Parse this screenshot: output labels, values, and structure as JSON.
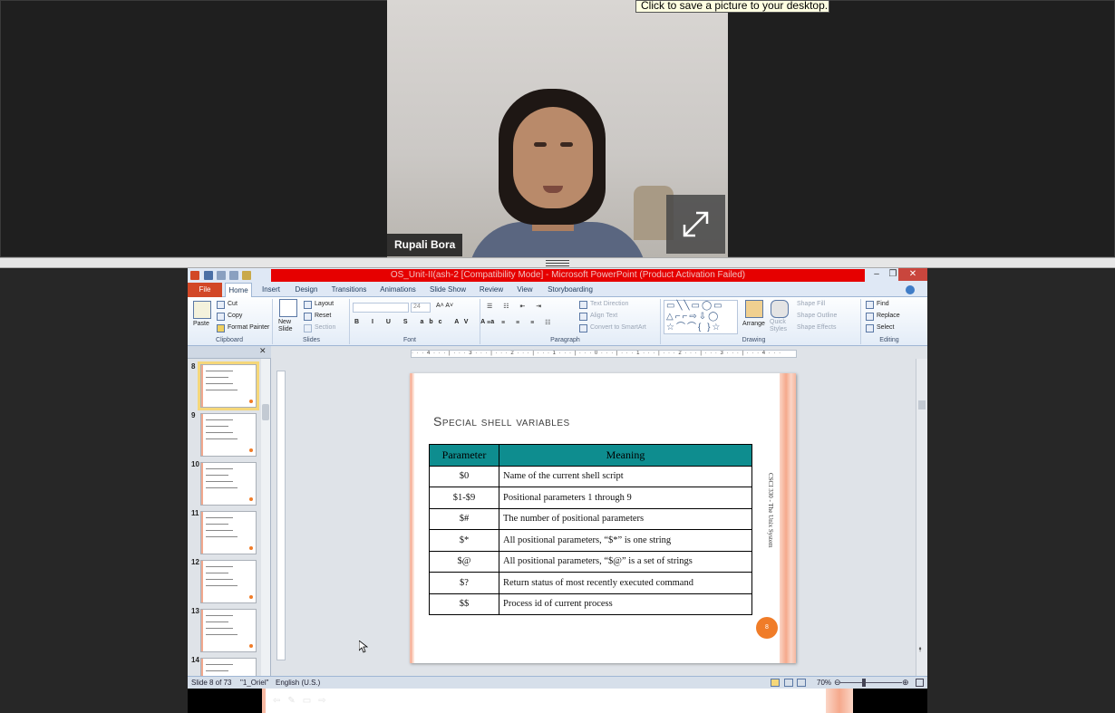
{
  "meeting": {
    "participant_name": "Rupali Bora",
    "tooltip": "Click to save a picture to your desktop."
  },
  "powerpoint": {
    "window_title": "OS_Unit-II(ash-2 [Compatibility Mode] - Microsoft PowerPoint (Product Activation Failed)",
    "tabs": [
      "File",
      "Home",
      "Insert",
      "Design",
      "Transitions",
      "Animations",
      "Slide Show",
      "Review",
      "View",
      "Storyboarding"
    ],
    "active_tab": "Home",
    "ribbon": {
      "clipboard": {
        "paste": "Paste",
        "cut": "Cut",
        "copy": "Copy",
        "format_painter": "Format Painter",
        "label": "Clipboard"
      },
      "slides": {
        "new_slide": "New Slide",
        "layout": "Layout",
        "reset": "Reset",
        "section": "Section",
        "label": "Slides"
      },
      "font": {
        "size": "24",
        "label": "Font"
      },
      "paragraph": {
        "text_direction": "Text Direction",
        "align_text": "Align Text",
        "convert_smartart": "Convert to SmartArt",
        "label": "Paragraph"
      },
      "drawing": {
        "arrange": "Arrange",
        "quick_styles": "Quick Styles",
        "shape_fill": "Shape Fill",
        "shape_outline": "Shape Outline",
        "shape_effects": "Shape Effects",
        "label": "Drawing"
      },
      "editing": {
        "find": "Find",
        "replace": "Replace",
        "select": "Select",
        "label": "Editing"
      }
    },
    "thumbnail_numbers": [
      "8",
      "9",
      "10",
      "11",
      "12",
      "13",
      "14"
    ],
    "ruler": "· · · 4 · · · | · · · 3 · · · | · · · 2 · · · | · · · 1 · · · | · · · 0 · · · | · · · 1 · · · | · · · 2 · · · | · · · 3 · · · | · · · 4 · · ·",
    "slide": {
      "title": "Special shell variables",
      "columns": [
        "Parameter",
        "Meaning"
      ],
      "rows": [
        [
          "$0",
          "Name of the current shell script"
        ],
        [
          "$1-$9",
          "Positional parameters 1 through 9"
        ],
        [
          "$#",
          "The number of positional parameters"
        ],
        [
          "$*",
          "All positional parameters, “$*” is one string"
        ],
        [
          "$@",
          "All positional parameters, “$@” is a set of strings"
        ],
        [
          "$?",
          "Return status of most recently executed command"
        ],
        [
          "$$",
          "Process id of current process"
        ]
      ],
      "side_text": "CSCI 330 - The Unix System",
      "page_number": "8"
    },
    "status": {
      "slide_info": "Slide 8 of 73",
      "theme": "\"1_Oriel\"",
      "language": "English (U.S.)",
      "zoom": "70%"
    },
    "accent_colors": {
      "table_header": "#0e8d8f",
      "badge": "#f07c28",
      "title_bar": "#e60000"
    }
  }
}
